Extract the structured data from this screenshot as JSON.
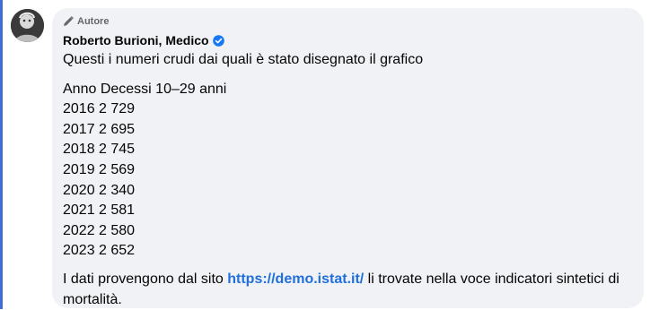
{
  "comment": {
    "badge_label": "Autore",
    "author_name": "Roberto Burioni, Medico",
    "intro": "Questi i numeri crudi dai quali è stato disegnato il grafico",
    "table_header": "Anno Decessi 10–29 anni",
    "rows": [
      "2016 2 729",
      "2017 2 695",
      "2018 2 745",
      "2019 2 569",
      "2020 2 340",
      "2021 2 581",
      "2022 2 580",
      "2023 2 652"
    ],
    "footer_before": "I dati provengono dal sito ",
    "footer_link": "https://demo.istat.it/",
    "footer_after": " li trovate nella voce indicatori sintetici di mortalità."
  },
  "colors": {
    "bubble": "#f0f2f5",
    "link": "#216fdb",
    "verified": "#1877f2",
    "left_rule": "#3b6fd6"
  },
  "icons": {
    "badge": "pencil-icon",
    "verified": "verified-badge-icon"
  }
}
